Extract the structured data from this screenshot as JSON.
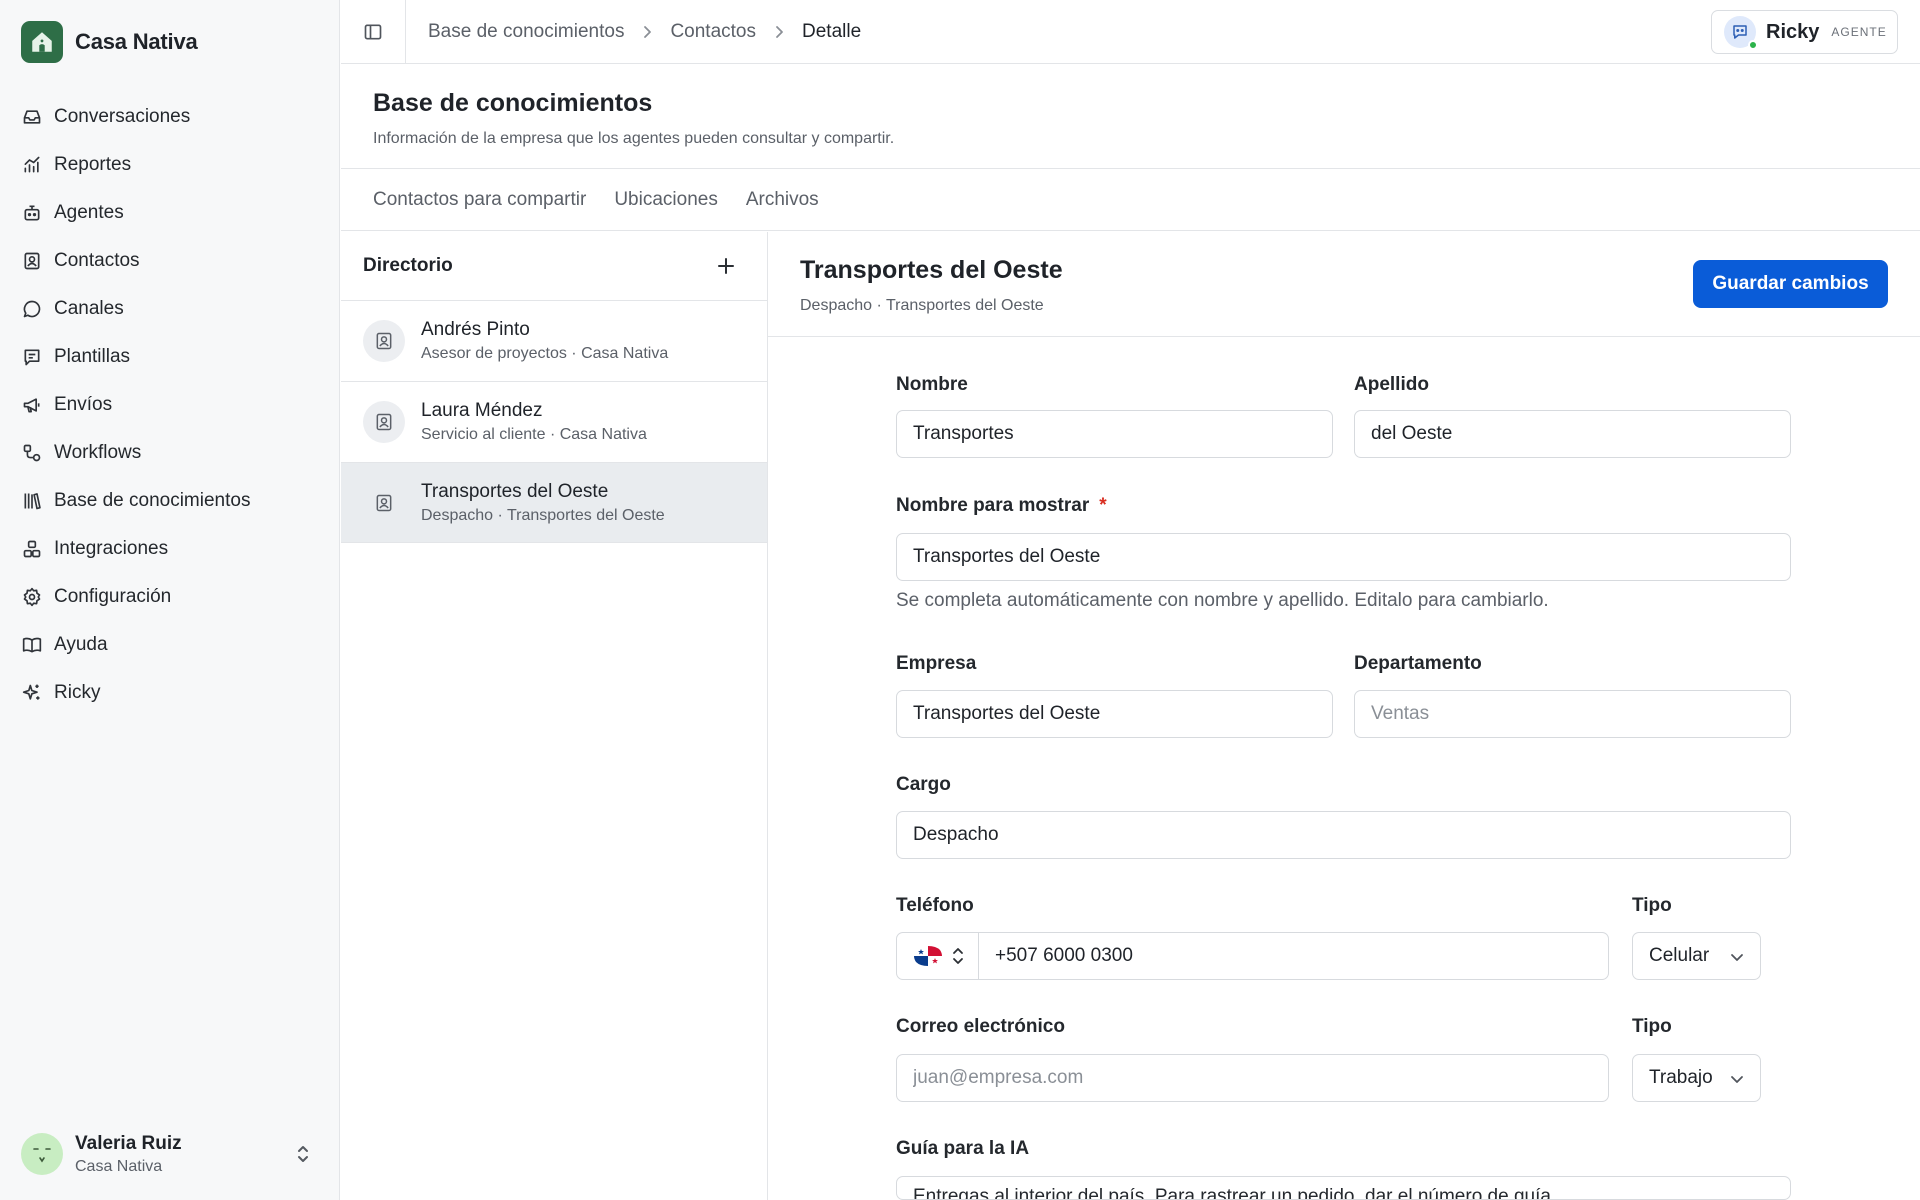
{
  "app": {
    "name": "Casa Nativa"
  },
  "sidebar": {
    "items": [
      {
        "label": "Conversaciones",
        "icon": "inbox-icon"
      },
      {
        "label": "Reportes",
        "icon": "chart-icon"
      },
      {
        "label": "Agentes",
        "icon": "bot-icon"
      },
      {
        "label": "Contactos",
        "icon": "contact-icon"
      },
      {
        "label": "Canales",
        "icon": "chat-bubble-icon"
      },
      {
        "label": "Plantillas",
        "icon": "template-icon"
      },
      {
        "label": "Envíos",
        "icon": "megaphone-icon"
      },
      {
        "label": "Workflows",
        "icon": "workflow-icon"
      },
      {
        "label": "Base de conocimientos",
        "icon": "library-icon"
      },
      {
        "label": "Integraciones",
        "icon": "integrations-icon"
      },
      {
        "label": "Configuración",
        "icon": "gear-icon"
      },
      {
        "label": "Ayuda",
        "icon": "book-icon"
      },
      {
        "label": "Ricky",
        "icon": "sparkle-icon"
      }
    ],
    "user": {
      "name": "Valeria Ruiz",
      "org": "Casa Nativa"
    }
  },
  "topbar": {
    "breadcrumb": [
      "Base de conocimientos",
      "Contactos",
      "Detalle"
    ],
    "agent": {
      "name": "Ricky",
      "role": "AGENTE",
      "status_color": "#2cb34a"
    }
  },
  "page": {
    "title": "Base de conocimientos",
    "subtitle": "Información de la empresa que los agentes pueden consultar y compartir.",
    "tabs": [
      "Contactos para compartir",
      "Ubicaciones",
      "Archivos"
    ]
  },
  "directory": {
    "title": "Directorio",
    "contacts": [
      {
        "name": "Andrés Pinto",
        "subtitle": "Asesor de proyectos · Casa Nativa",
        "selected": false
      },
      {
        "name": "Laura Méndez",
        "subtitle": "Servicio al cliente · Casa Nativa",
        "selected": false
      },
      {
        "name": "Transportes del Oeste",
        "subtitle": "Despacho · Transportes del Oeste",
        "selected": true
      }
    ]
  },
  "detail": {
    "title": "Transportes del Oeste",
    "subtitle": "Despacho · Transportes del Oeste",
    "save_label": "Guardar cambios",
    "save_color": "#0a5cd8",
    "form": {
      "first_name": {
        "label": "Nombre",
        "value": "Transportes"
      },
      "last_name": {
        "label": "Apellido",
        "value": "del Oeste"
      },
      "display_name": {
        "label": "Nombre para mostrar",
        "required_mark": "*",
        "value": "Transportes del Oeste",
        "hint": "Se completa automáticamente con nombre y apellido. Editalo para cambiarlo."
      },
      "company": {
        "label": "Empresa",
        "value": "Transportes del Oeste"
      },
      "department": {
        "label": "Departamento",
        "value": "",
        "placeholder": "Ventas"
      },
      "position": {
        "label": "Cargo",
        "value": "Despacho"
      },
      "phone": {
        "label": "Teléfono",
        "value": "+507 6000 0300",
        "country_flag": "panama-flag-icon",
        "type_label": "Tipo",
        "type_value": "Celular"
      },
      "email": {
        "label": "Correo electrónico",
        "value": "",
        "placeholder": "juan@empresa.com",
        "type_label": "Tipo",
        "type_value": "Trabajo"
      },
      "ai_guide": {
        "label": "Guía para la IA",
        "value": "Entregas al interior del país. Para rastrear un pedido, dar el número de guía."
      }
    }
  }
}
